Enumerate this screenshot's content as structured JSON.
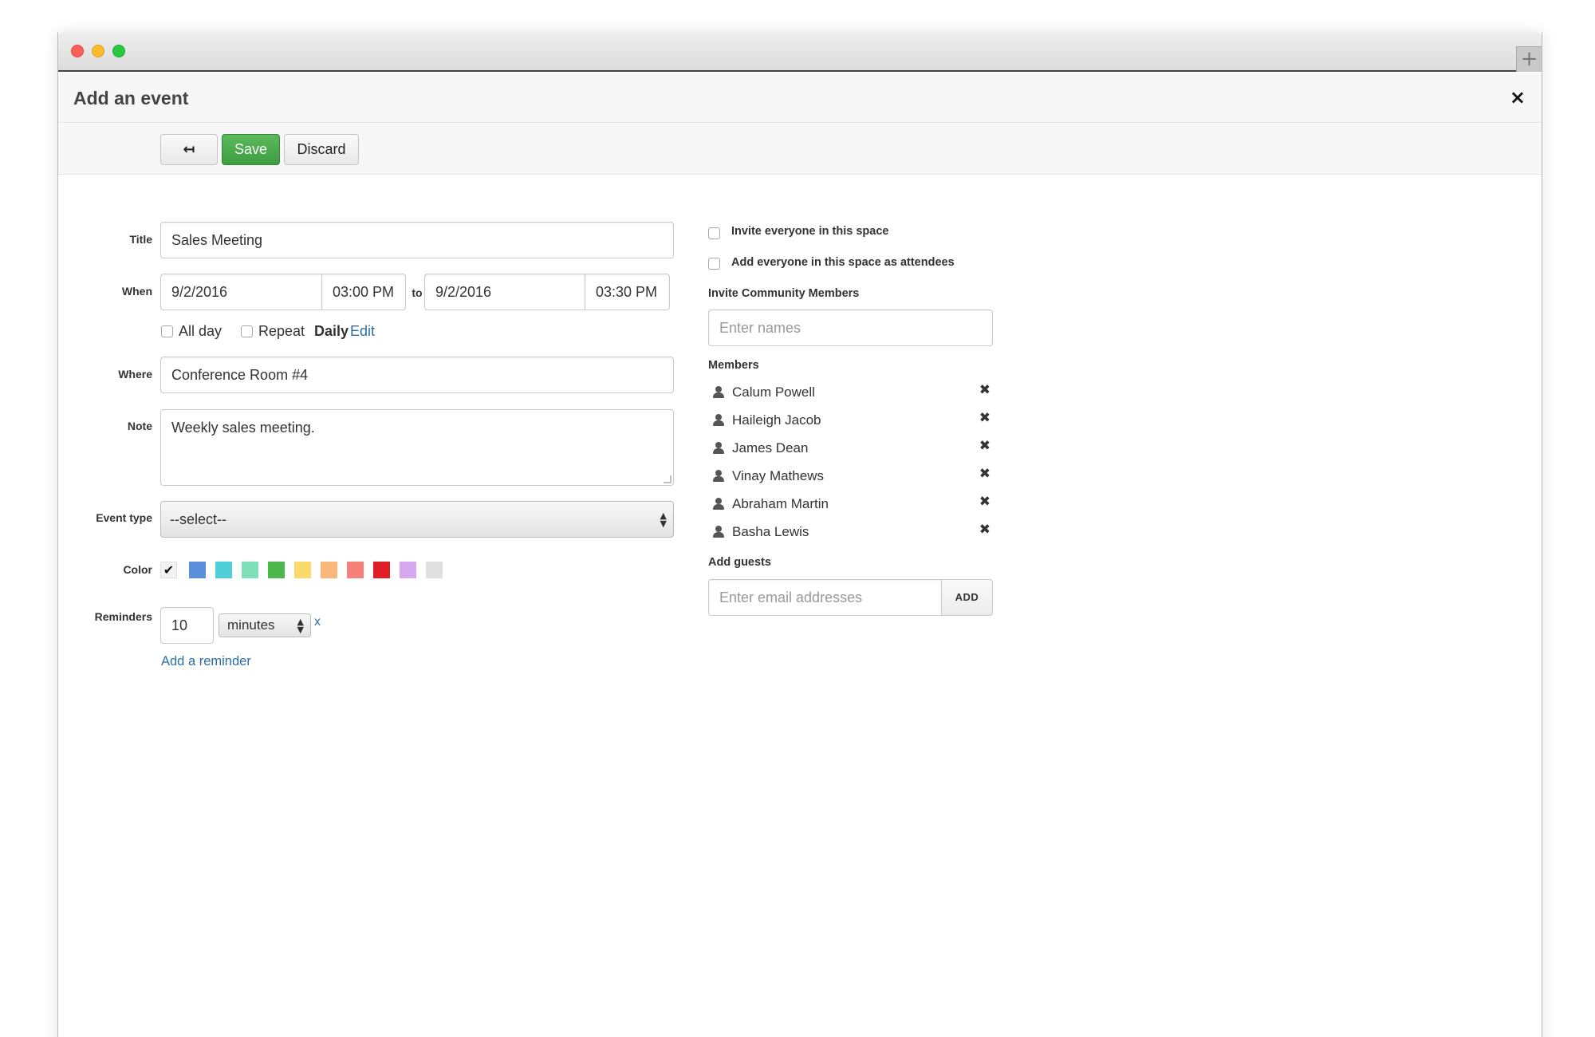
{
  "window": {
    "newtab_glyph": "+"
  },
  "header": {
    "title": "Add an event",
    "close_glyph": "×"
  },
  "toolbar": {
    "back_glyph": "↤",
    "save_label": "Save",
    "discard_label": "Discard"
  },
  "form": {
    "title_label": "Title",
    "title_value": "Sales Meeting",
    "when_label": "When",
    "start_date": "9/2/2016",
    "start_time": "03:00 PM",
    "to_label": "to",
    "end_date": "9/2/2016",
    "end_time": "03:30 PM",
    "allday_label": "All day",
    "repeat_label": "Repeat",
    "repeat_value": "Daily",
    "repeat_edit": "Edit",
    "where_label": "Where",
    "where_value": "Conference Room #4",
    "note_label": "Note",
    "note_value": "Weekly sales meeting.",
    "event_type_label": "Event type",
    "event_type_value": "--select--",
    "color_label": "Color",
    "colors": [
      "#5b8fdb",
      "#4fd0d8",
      "#7fdfb8",
      "#4cb84c",
      "#fbd96a",
      "#fbb67a",
      "#f5807a",
      "#e01e28",
      "#d5a8f0",
      "#e0e0e0"
    ],
    "selected_check": "✔",
    "reminders_label": "Reminders",
    "reminder_value": "10",
    "reminder_unit": "minutes",
    "reminder_remove": "x",
    "add_reminder": "Add a reminder"
  },
  "invite": {
    "invite_everyone": "Invite everyone in this space",
    "add_everyone": "Add everyone in this space as attendees",
    "community_label": "Invite Community Members",
    "names_placeholder": "Enter names",
    "members_label": "Members",
    "members": [
      "Calum Powell",
      "Haileigh Jacob",
      "James Dean",
      "Vinay Mathews",
      "Abraham Martin",
      "Basha Lewis"
    ],
    "remove_glyph": "✖",
    "guests_label": "Add guests",
    "email_placeholder": "Enter email addresses",
    "add_label": "ADD"
  }
}
